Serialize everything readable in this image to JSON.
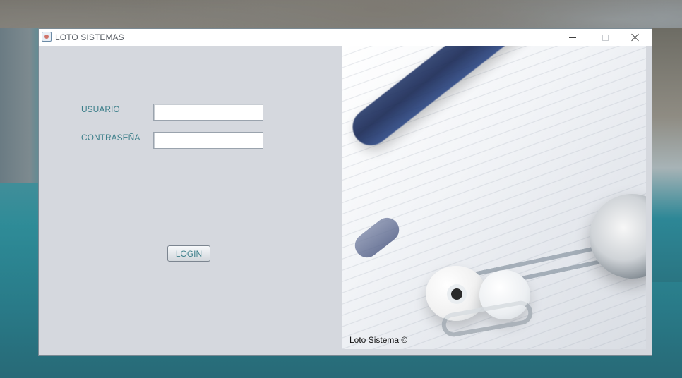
{
  "window": {
    "title": "LOTO SISTEMAS",
    "controls": {
      "minimize": "minimize",
      "maximize": "maximize",
      "close": "close"
    }
  },
  "form": {
    "usuario_label": "USUARIO",
    "usuario_value": "",
    "contrasena_label": "CONTRASEÑA",
    "contrasena_value": "",
    "login_label": "LOGIN"
  },
  "image": {
    "caption": "Loto Sistema ©"
  },
  "colors": {
    "label_teal": "#3d7f8a",
    "window_bg": "#d5d8de",
    "titlebar_bg": "#ffffff"
  },
  "icons": {
    "app": "java-app-icon",
    "minimize": "minimize-icon",
    "maximize": "maximize-icon",
    "close": "close-icon"
  }
}
